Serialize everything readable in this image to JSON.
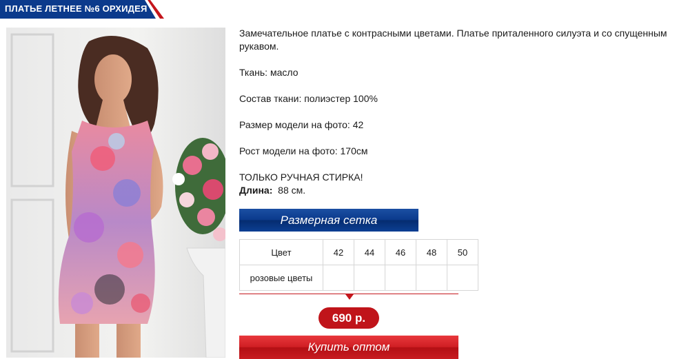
{
  "title": "ПЛАТЬЕ ЛЕТНЕЕ №6 ОРХИДЕЯ",
  "description": {
    "intro": "Замечательное платье с контрасными цветами. Платье приталенного силуэта и со спущенным рукавом.",
    "fabric": "Ткань: масло",
    "composition": "Состав ткани: полиэстер 100%",
    "model_size": "Размер модели на фото: 42",
    "model_height": "Рост модели на фото: 170см",
    "wash": "ТОЛЬКО РУЧНАЯ СТИРКА!",
    "length_label": "Длина:",
    "length_value": "88 см."
  },
  "size_chart_button": "Размерная сетка",
  "size_table": {
    "header": [
      "Цвет",
      "42",
      "44",
      "46",
      "48",
      "50"
    ],
    "rows": [
      {
        "color": "розовые цветы",
        "cells": [
          "",
          "",
          "",
          "",
          ""
        ]
      }
    ]
  },
  "price": "690 р.",
  "buy_button": "Купить оптом",
  "colors": {
    "title_bg": "#0b3a8c",
    "accent_red": "#c4161c",
    "button_blue": "#0b3a8c"
  }
}
